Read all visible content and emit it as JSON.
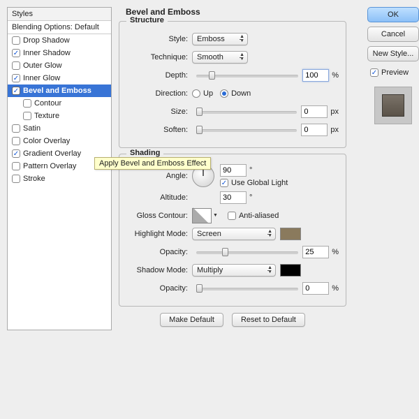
{
  "left": {
    "header": "Styles",
    "blending": "Blending Options: Default",
    "items": [
      {
        "label": "Drop Shadow",
        "checked": false,
        "indent": false
      },
      {
        "label": "Inner Shadow",
        "checked": true,
        "indent": false
      },
      {
        "label": "Outer Glow",
        "checked": false,
        "indent": false
      },
      {
        "label": "Inner Glow",
        "checked": true,
        "indent": false
      },
      {
        "label": "Bevel and Emboss",
        "checked": true,
        "indent": false,
        "selected": true
      },
      {
        "label": "Contour",
        "checked": false,
        "indent": true
      },
      {
        "label": "Texture",
        "checked": false,
        "indent": true
      },
      {
        "label": "Satin",
        "checked": false,
        "indent": false
      },
      {
        "label": "Color Overlay",
        "checked": false,
        "indent": false
      },
      {
        "label": "Gradient Overlay",
        "checked": true,
        "indent": false
      },
      {
        "label": "Pattern Overlay",
        "checked": false,
        "indent": false
      },
      {
        "label": "Stroke",
        "checked": false,
        "indent": false
      }
    ]
  },
  "center": {
    "title": "Bevel and Emboss",
    "structure": {
      "legend": "Structure",
      "style_label": "Style:",
      "style_value": "Emboss",
      "technique_label": "Technique:",
      "technique_value": "Smooth",
      "depth_label": "Depth:",
      "depth_value": "100",
      "depth_unit": "%",
      "direction_label": "Direction:",
      "direction_up": "Up",
      "direction_down": "Down",
      "size_label": "Size:",
      "size_value": "0",
      "size_unit": "px",
      "soften_label": "Soften:",
      "soften_value": "0",
      "soften_unit": "px"
    },
    "shading": {
      "legend": "Shading",
      "angle_label": "Angle:",
      "angle_value": "90",
      "angle_unit": "°",
      "global_light": "Use Global Light",
      "altitude_label": "Altitude:",
      "altitude_value": "30",
      "altitude_unit": "°",
      "gloss_label": "Gloss Contour:",
      "antialiased": "Anti-aliased",
      "highlight_mode_label": "Highlight Mode:",
      "highlight_mode_value": "Screen",
      "highlight_color": "#8a7a5d",
      "highlight_opacity_label": "Opacity:",
      "highlight_opacity_value": "25",
      "highlight_opacity_unit": "%",
      "shadow_mode_label": "Shadow Mode:",
      "shadow_mode_value": "Multiply",
      "shadow_color": "#000000",
      "shadow_opacity_label": "Opacity:",
      "shadow_opacity_value": "0",
      "shadow_opacity_unit": "%"
    },
    "buttons": {
      "make_default": "Make Default",
      "reset_default": "Reset to Default"
    }
  },
  "right": {
    "ok": "OK",
    "cancel": "Cancel",
    "new_style": "New Style...",
    "preview": "Preview"
  },
  "tooltip": "Apply Bevel and Emboss Effect"
}
